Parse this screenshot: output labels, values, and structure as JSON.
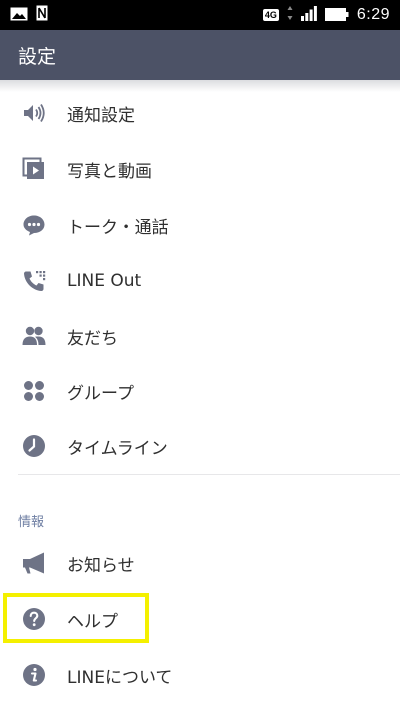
{
  "status_bar": {
    "network": "4G",
    "time": "6:29"
  },
  "header": {
    "title": "設定"
  },
  "settings": {
    "items": [
      {
        "label": "通知設定",
        "icon": "speaker-icon"
      },
      {
        "label": "写真と動画",
        "icon": "photo-video-icon"
      },
      {
        "label": "トーク・通話",
        "icon": "chat-bubble-icon"
      },
      {
        "label": "LINE Out",
        "icon": "phone-out-icon"
      },
      {
        "label": "友だち",
        "icon": "friends-icon"
      },
      {
        "label": "グループ",
        "icon": "group-icon"
      },
      {
        "label": "タイムライン",
        "icon": "clock-icon"
      }
    ]
  },
  "info": {
    "section_label": "情報",
    "items": [
      {
        "label": "お知らせ",
        "icon": "megaphone-icon"
      },
      {
        "label": "ヘルプ",
        "icon": "help-icon",
        "highlighted": true
      },
      {
        "label": "LINEについて",
        "icon": "info-icon"
      }
    ]
  },
  "colors": {
    "header_bg": "#4c5266",
    "icon": "#6e7386",
    "section_label": "#6f7fa3",
    "highlight": "#f4f000"
  }
}
